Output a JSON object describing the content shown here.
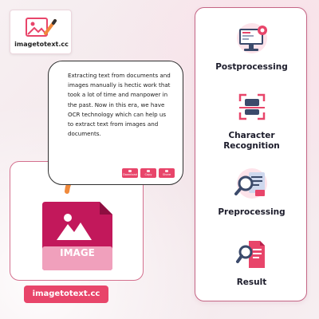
{
  "brand": {
    "logo_text": "imagetotext.cc",
    "badge_text": "imagetotext.cc",
    "accent": "#e8456a",
    "image_tile_color": "#c2185b"
  },
  "image_card": {
    "label": "IMAGE"
  },
  "text_card": {
    "body": "Extracting text from documents and images manually is hectic work that took a lot of time and manpower in the past. Now in this era, we have OCR technology which can help us to extract text from images and documents.",
    "buttons": [
      {
        "label": "Download",
        "icon": "download-icon"
      },
      {
        "label": "Copy",
        "icon": "copy-icon"
      },
      {
        "label": "Share",
        "icon": "share-icon"
      }
    ]
  },
  "steps": [
    {
      "label_line1": "Postprocessing",
      "label_line2": "",
      "icon": "computer-gear-icon"
    },
    {
      "label_line1": "Character",
      "label_line2": "Recognition",
      "icon": "scan-frame-icon"
    },
    {
      "label_line1": "Preprocessing",
      "label_line2": "",
      "icon": "magnifier-documents-icon"
    },
    {
      "label_line1": "Result",
      "label_line2": "",
      "icon": "document-magnifier-icon"
    }
  ]
}
